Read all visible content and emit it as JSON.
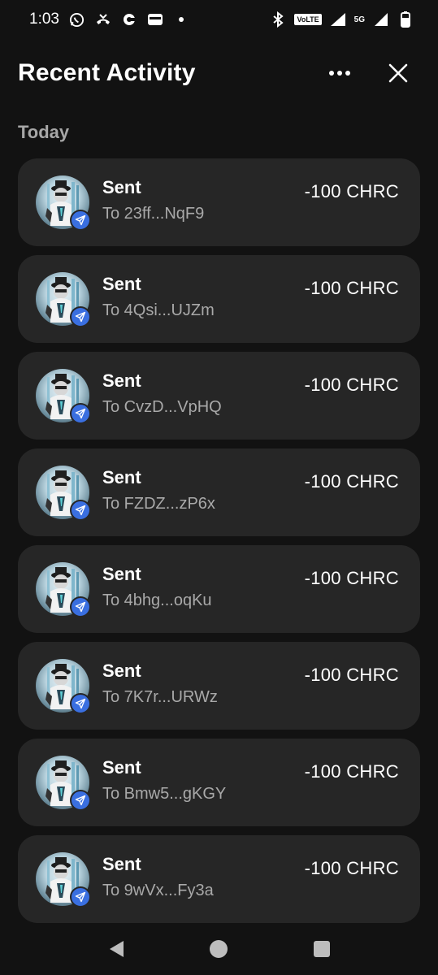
{
  "status_bar": {
    "time": "1:03",
    "volte": "VoLTE",
    "network": "5G"
  },
  "header": {
    "title": "Recent Activity"
  },
  "section": {
    "label": "Today"
  },
  "activities": [
    {
      "type": "Sent",
      "recipient": "To 23ff...NqF9",
      "amount": "-100 CHRC"
    },
    {
      "type": "Sent",
      "recipient": "To 4Qsi...UJZm",
      "amount": "-100 CHRC"
    },
    {
      "type": "Sent",
      "recipient": "To CvzD...VpHQ",
      "amount": "-100 CHRC"
    },
    {
      "type": "Sent",
      "recipient": "To FZDZ...zP6x",
      "amount": "-100 CHRC"
    },
    {
      "type": "Sent",
      "recipient": "To 4bhg...oqKu",
      "amount": "-100 CHRC"
    },
    {
      "type": "Sent",
      "recipient": "To 7K7r...URWz",
      "amount": "-100 CHRC"
    },
    {
      "type": "Sent",
      "recipient": "To Bmw5...gKGY",
      "amount": "-100 CHRC"
    },
    {
      "type": "Sent",
      "recipient": "To 9wVx...Fy3a",
      "amount": "-100 CHRC"
    }
  ],
  "icons": {
    "more": "more-horizontal-icon",
    "close": "close-icon",
    "send": "send-icon",
    "back": "nav-back-icon",
    "home": "nav-home-icon",
    "recents": "nav-recents-icon"
  },
  "colors": {
    "background": "#121212",
    "card": "#262626",
    "badge": "#3a6fe0",
    "muted_text": "#a9a9a9"
  }
}
